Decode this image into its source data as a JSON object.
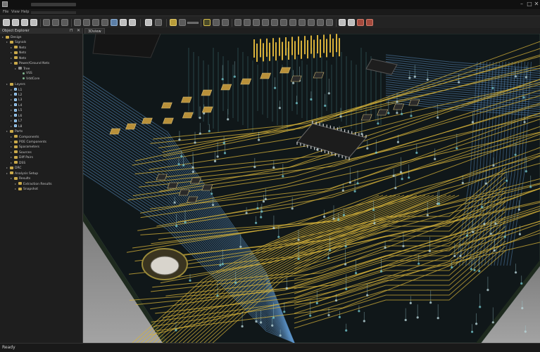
{
  "menu": {
    "items": [
      "File",
      "View",
      "Help"
    ]
  },
  "toolbar": {
    "icons": [
      "new-icon",
      "open-icon",
      "save-icon",
      "print-icon",
      "undo-icon",
      "redo-icon",
      "cut-icon",
      "copy-icon",
      "paste-icon",
      "zoom-in-icon",
      "zoom-out-icon",
      "zoom-fit-icon",
      "select-icon",
      "rotate-icon",
      "layer-icon",
      "grid-icon",
      "view-top-icon",
      "view-bottom-icon",
      "view-iso-icon",
      "view-front-icon",
      "view-back-icon",
      "view-left-icon",
      "view-right-icon",
      "measure-icon",
      "settings-icon",
      "stop-icon"
    ]
  },
  "explorer": {
    "title": "Object Explorer",
    "pin": "⊓",
    "close": "✕",
    "tree": [
      {
        "level": 0,
        "label": "Design",
        "icon": "folder"
      },
      {
        "level": 1,
        "label": "Signals",
        "icon": "folder"
      },
      {
        "level": 2,
        "label": "Nets",
        "icon": "folder"
      },
      {
        "level": 2,
        "label": "Nets",
        "icon": "folder"
      },
      {
        "level": 2,
        "label": "Nets",
        "icon": "folder"
      },
      {
        "level": 2,
        "label": "Power/Ground Nets",
        "icon": "folder"
      },
      {
        "level": 3,
        "label": "Tree",
        "icon": "gray"
      },
      {
        "level": 4,
        "label": "VSS",
        "icon": "dot"
      },
      {
        "level": 4,
        "label": "VddCore",
        "icon": "dot"
      },
      {
        "level": 1,
        "label": "Layers",
        "icon": "folder"
      },
      {
        "level": 2,
        "label": "L1",
        "icon": "layer"
      },
      {
        "level": 2,
        "label": "L2",
        "icon": "layer"
      },
      {
        "level": 2,
        "label": "L3",
        "icon": "layer"
      },
      {
        "level": 2,
        "label": "L4",
        "icon": "layer"
      },
      {
        "level": 2,
        "label": "L5",
        "icon": "layer"
      },
      {
        "level": 2,
        "label": "L6",
        "icon": "layer"
      },
      {
        "level": 2,
        "label": "L7",
        "icon": "layer"
      },
      {
        "level": 2,
        "label": "L8",
        "icon": "layer"
      },
      {
        "level": 1,
        "label": "Parts",
        "icon": "folder"
      },
      {
        "level": 2,
        "label": "Components",
        "icon": "folder"
      },
      {
        "level": 2,
        "label": "POE Components",
        "icon": "folder"
      },
      {
        "level": 2,
        "label": "Sparameters",
        "icon": "folder"
      },
      {
        "level": 2,
        "label": "Sources",
        "icon": "folder"
      },
      {
        "level": 2,
        "label": "Diff Pairs",
        "icon": "folder"
      },
      {
        "level": 2,
        "label": "DSS",
        "icon": "folder"
      },
      {
        "level": 1,
        "label": "DRC",
        "icon": "folder"
      },
      {
        "level": 1,
        "label": "Analysis Setup",
        "icon": "folder"
      },
      {
        "level": 2,
        "label": "Results",
        "icon": "folder"
      },
      {
        "level": 3,
        "label": "Extraction Results",
        "icon": "folder"
      },
      {
        "level": 3,
        "label": "Snapshot",
        "icon": "folder"
      }
    ]
  },
  "view": {
    "tab_label": "3Dview"
  },
  "status": {
    "text": "Ready"
  },
  "colors": {
    "trace_yellow": "#d9b53a",
    "trace_blue": "#5d93c9",
    "trace_cyan": "#6cc0c7",
    "board": "#0f1517",
    "accent_toolbar_select": "#d8c04a"
  }
}
